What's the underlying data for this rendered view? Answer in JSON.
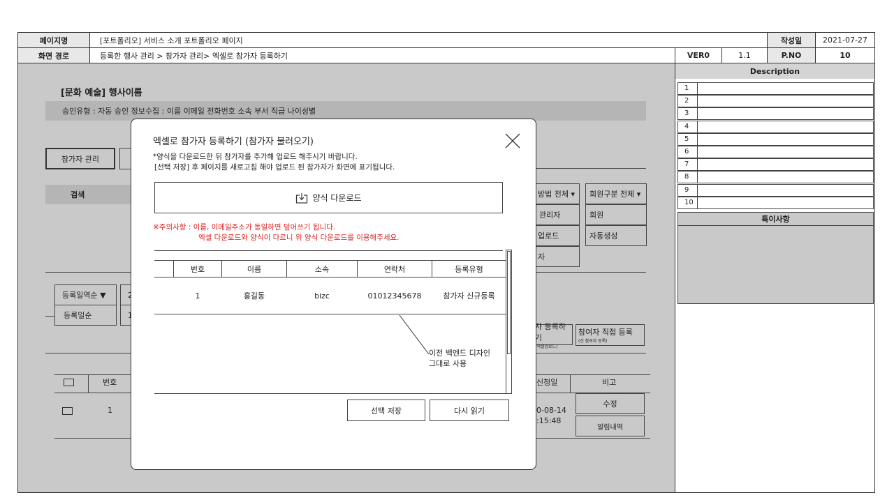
{
  "header": {
    "page_name_label": "페이지명",
    "page_name": "[포트폴리오] 서비스 소개 포트폴리오 페이지",
    "created_label": "작성일",
    "created_date": "2021-07-27",
    "route_label": "화면 경로",
    "route": "등록한 행사 관리 > 참가자 관리> 엑셀로 참가자 등록하기",
    "version_label": "VER0",
    "version": "1.1",
    "pno_label": "P.NO",
    "pno": "10"
  },
  "description": {
    "title": "Description",
    "rows": [
      "1",
      "2",
      "3",
      "4",
      "5",
      "6",
      "7",
      "8",
      "9",
      "10"
    ],
    "notes_title": "특이사항"
  },
  "background": {
    "event_title": "[문화 예술] 행사이름",
    "info_bar": "승인유형 : 자동 승인  정보수집 : 이름 이메일 전화번호 소속 부서 직급 나이성별",
    "participant_tab": "참가자 관리",
    "search_label": "검색",
    "method_filter": "방법 전체 ▾",
    "member_filter": "회원구분 전체 ▾",
    "method_options": [
      "관리자",
      "업로드",
      "자"
    ],
    "member_options": [
      "회원",
      "자동생성"
    ],
    "sort_select": "등록일역순 ▼",
    "sort_option": "등록일순",
    "sort_select_2": "2",
    "sort_option_2": "1",
    "excel_register_button": "자 등록하기",
    "excel_register_sub": "(엑셀업로드)",
    "direct_register_button": "참여자 직접 등록",
    "direct_register_sub": "(신 참여자 등록)",
    "table_headers": [
      "번호",
      "신청일",
      "비고"
    ],
    "row": {
      "no": "1",
      "date_line1": "0-08-14",
      "date_line2": ":15:48"
    },
    "edit_button": "수정",
    "notify_button": "알림내역"
  },
  "modal": {
    "title": "엑셀로 참가자 등록하기 (참가자 불러오기)",
    "desc_line1": "*양식을 다운로드한 뒤 참가자를 추가해 업로드 해주시기 바랍니다.",
    "desc_line2": "[선택 저장] 후 페이지를 새로고침 해야 업로드 된 참가자가 화면에 표기됩니다.",
    "download_button": "양식 다운로드",
    "download_icon": "download-icon",
    "warning_line1": "※주의사항 : 이름, 이메일주소가 동일하면 덮어쓰기 됩니다.",
    "warning_line2": "엑셀 다운로드와 양식이 다르니 위 양식 다운로드를 이용해주세요.",
    "table_headers": [
      "번호",
      "이름",
      "소속",
      "연락처",
      "등록유형"
    ],
    "rows": [
      {
        "no": "1",
        "name": "홍길동",
        "org": "bizc",
        "phone": "01012345678",
        "type": "참가자 신규등록"
      }
    ],
    "annotation_line1": "이전 백엔드 디자인",
    "annotation_line2": "그대로 사용",
    "save_button": "선택 저장",
    "reload_button": "다시 읽기",
    "warning_color": "#e02020"
  }
}
